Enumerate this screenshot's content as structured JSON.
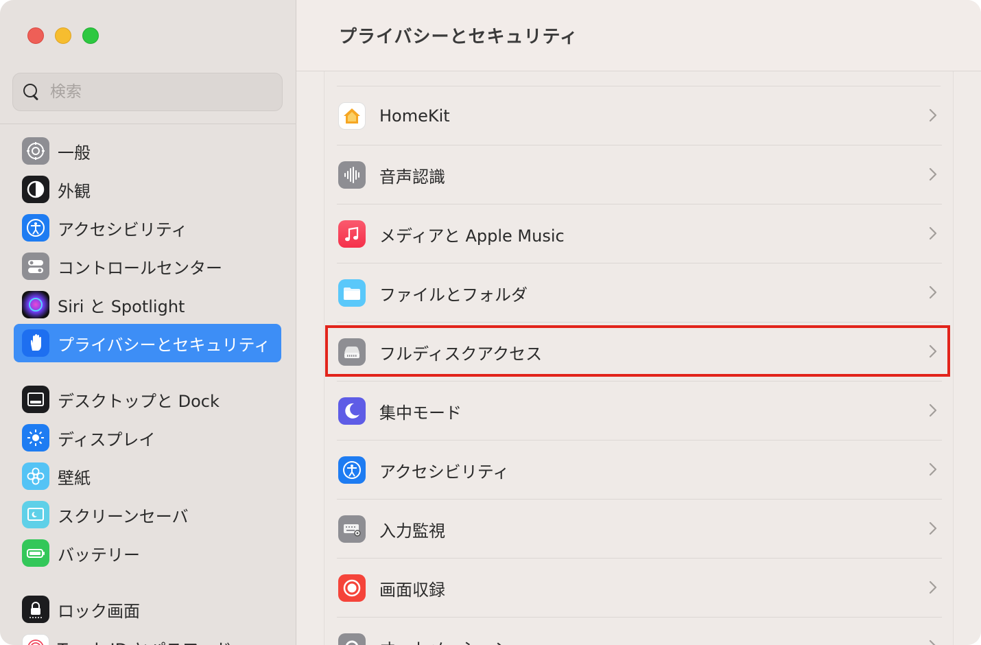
{
  "window": {
    "title": "プライバシーとセキュリティ"
  },
  "search": {
    "placeholder": "検索",
    "value": ""
  },
  "sidebar": {
    "items": [
      {
        "label": "一般",
        "icon": "gear-icon",
        "active": false
      },
      {
        "label": "外観",
        "icon": "appearance-icon",
        "active": false
      },
      {
        "label": "アクセシビリティ",
        "icon": "accessibility-icon",
        "active": false
      },
      {
        "label": "コントロールセンター",
        "icon": "control-center-icon",
        "active": false
      },
      {
        "label": "Siri と Spotlight",
        "icon": "siri-icon",
        "active": false
      },
      {
        "label": "プライバシーとセキュリティ",
        "icon": "hand-icon",
        "active": true
      },
      {
        "label": "デスクトップと Dock",
        "icon": "dock-icon",
        "active": false
      },
      {
        "label": "ディスプレイ",
        "icon": "sun-icon",
        "active": false
      },
      {
        "label": "壁紙",
        "icon": "flower-icon",
        "active": false
      },
      {
        "label": "スクリーンセーバ",
        "icon": "screensaver-icon",
        "active": false
      },
      {
        "label": "バッテリー",
        "icon": "battery-icon",
        "active": false
      },
      {
        "label": "ロック画面",
        "icon": "lock-icon",
        "active": false
      },
      {
        "label": "Touch ID とパスワード",
        "icon": "fingerprint-icon",
        "active": false
      }
    ]
  },
  "main": {
    "rows": [
      {
        "label": "HomeKit",
        "icon": "home-icon"
      },
      {
        "label": "音声認識",
        "icon": "waveform-icon"
      },
      {
        "label": "メディアと Apple Music",
        "icon": "music-note-icon"
      },
      {
        "label": "ファイルとフォルダ",
        "icon": "folder-icon"
      },
      {
        "label": "フルディスクアクセス",
        "icon": "disk-icon",
        "highlighted": true
      },
      {
        "label": "集中モード",
        "icon": "moon-icon"
      },
      {
        "label": "アクセシビリティ",
        "icon": "accessibility-icon"
      },
      {
        "label": "入力監視",
        "icon": "keyboard-icon"
      },
      {
        "label": "画面収録",
        "icon": "record-icon"
      },
      {
        "label": "オートメーション",
        "icon": "gear-icon"
      }
    ]
  },
  "colors": {
    "accent": "#3d8ef6",
    "highlight_box": "#e2241b"
  }
}
